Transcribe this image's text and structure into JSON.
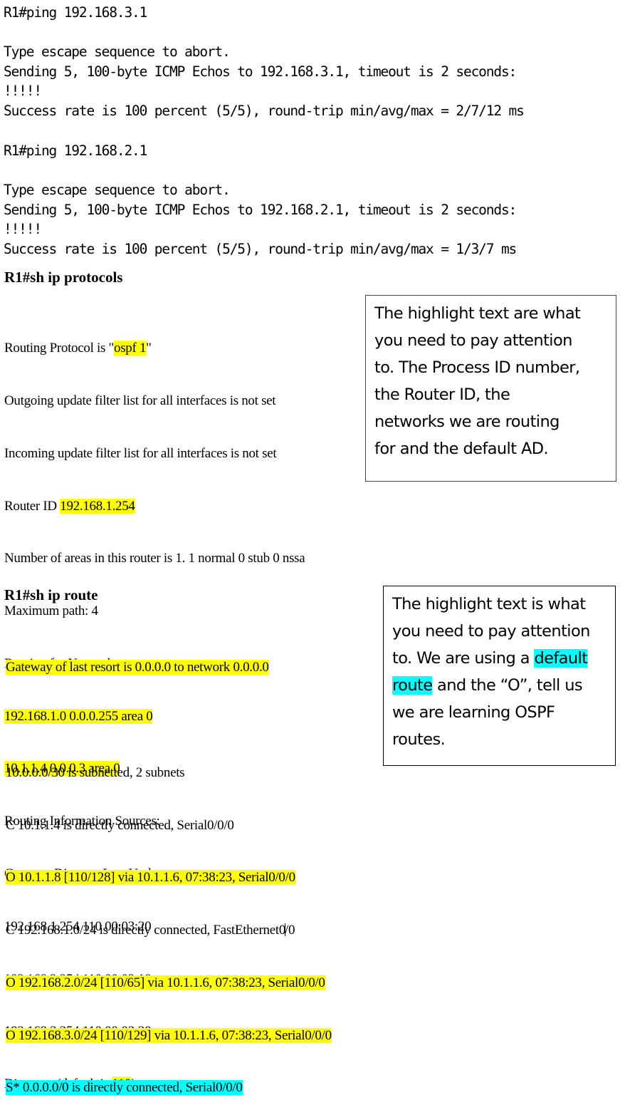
{
  "ping1": {
    "command": "R1#ping 192.168.3.1",
    "lines": [
      "Type escape sequence to abort.",
      "Sending 5, 100-byte ICMP Echos to 192.168.3.1, timeout is 2 seconds:",
      "!!!!!",
      "Success rate is 100 percent (5/5), round-trip min/avg/max = 2/7/12 ms"
    ]
  },
  "ping2": {
    "command": "R1#ping 192.168.2.1",
    "lines": [
      "Type escape sequence to abort.",
      "Sending 5, 100-byte ICMP Echos to 192.168.2.1, timeout is 2 seconds:",
      "!!!!!",
      "Success rate is 100 percent (5/5), round-trip min/avg/max = 1/3/7 ms"
    ]
  },
  "protocols": {
    "command": "R1#sh ip protocols",
    "routing_protocol_prefix": "Routing Protocol is \"",
    "routing_protocol_value": "ospf 1",
    "routing_protocol_suffix": "\"",
    "outgoing": "Outgoing update filter list for all interfaces is not set",
    "incoming": "Incoming update filter list for all interfaces is not set",
    "router_id_label": "Router ID ",
    "router_id_value": "192.168.1.254",
    "areas": "Number of areas in this router is 1. 1 normal 0 stub 0 nssa",
    "max_path": "Maximum path: 4",
    "routing_for_networks": "Routing for Networks:",
    "networks": [
      "192.168.1.0 0.0.0.255 area 0",
      "10.1.1.4 0.0.0.3 area 0"
    ],
    "info_sources": "Routing Information Sources:",
    "sources_header": "Gateway Distance Last Update",
    "sources": [
      "192.168.1.254 110 00:03:20",
      "192.168.2.254 110 00:03:18",
      "192.168.3.254 110 00:03:20"
    ],
    "distance_prefix": "Distance: (default is ",
    "distance_value": "110",
    "distance_suffix": ")"
  },
  "note1": {
    "lines": [
      "The highlight text are what",
      "you need to pay attention",
      "to. The Process ID number,",
      "the Router ID, the",
      "networks we are routing",
      "for and the default AD."
    ]
  },
  "route": {
    "command": "R1#sh ip route",
    "gateway": "Gateway of last resort is 0.0.0.0 to network 0.0.0.0",
    "subnetted": "10.0.0.0/30 is subnetted, 2 subnets",
    "entries": [
      "C 10.1.1.4 is directly connected, Serial0/0/0",
      "O 10.1.1.8 [110/128] via 10.1.1.6, 07:38:23, Serial0/0/0",
      "C 192.168.1.0/24 is directly connected, FastEthernet0",
      "/0",
      "O 192.168.2.0/24 [110/65] via 10.1.1.6, 07:38:23, Serial0/0/0",
      "O 192.168.3.0/24 [110/129] via 10.1.1.6, 07:38:23, Serial0/0/0",
      "S* 0.0.0.0/0 is directly connected, Serial0/0/0"
    ]
  },
  "note2": {
    "line1": "The highlight text is what",
    "line2": "you need to pay attention",
    "line3_prefix": "to. We are using a ",
    "line3_highlight": "default",
    "line4_highlight": "route",
    "line4_suffix": " and the “O”, tell us",
    "line5": "we are learning OSPF",
    "line6": "routes."
  },
  "colors": {
    "highlight_yellow": "#ffff00",
    "highlight_cyan": "#00ffff"
  }
}
